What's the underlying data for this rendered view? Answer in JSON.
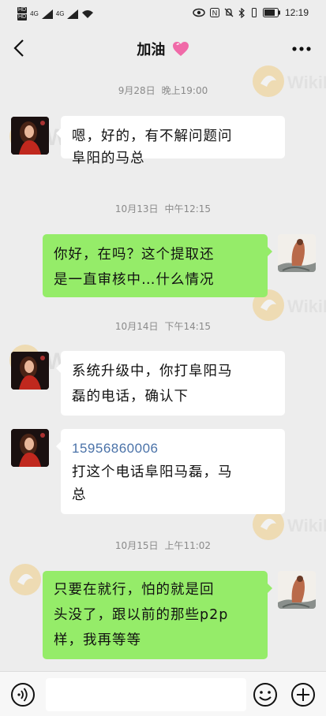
{
  "status_bar": {
    "sim_labels": [
      "HD",
      "HD"
    ],
    "network_labels": [
      "4G",
      "4G"
    ],
    "time": "12:19"
  },
  "header": {
    "title": "加油",
    "title_emoji_icon": "pink-heart-icon"
  },
  "messages": [
    {
      "type": "time",
      "date": "9月28日",
      "time": "晚上19:00"
    },
    {
      "type": "message",
      "side": "left",
      "lines": [
        "嗯，好的，有不解问题问",
        "阜阳的马总"
      ]
    },
    {
      "type": "time",
      "date": "10月13日",
      "time": "中午12:15"
    },
    {
      "type": "message",
      "side": "right",
      "lines": [
        "你好，在吗？这个提取还",
        "是一直审核中…什么情况"
      ]
    },
    {
      "type": "time",
      "date": "10月14日",
      "time": "下午14:15"
    },
    {
      "type": "message",
      "side": "left",
      "lines": [
        "系统升级中，你打阜阳马",
        "磊的电话，确认下"
      ]
    },
    {
      "type": "message",
      "side": "left",
      "phone": "15956860006",
      "lines": [
        "打这个电话阜阳马磊，马",
        "总"
      ]
    },
    {
      "type": "time",
      "date": "10月15日",
      "time": "上午11:02"
    },
    {
      "type": "message",
      "side": "right",
      "lines": [
        "只要在就行，怕的就是回",
        "头没了，跟以前的那些p2p",
        "样，我再等等"
      ]
    }
  ],
  "watermark_text": "WikiFX",
  "colors": {
    "background": "#ededed",
    "sent_bubble": "#95ec69",
    "received_bubble": "#ffffff",
    "timestamp": "#8a8a8a",
    "phone_link": "#4a72a8"
  }
}
